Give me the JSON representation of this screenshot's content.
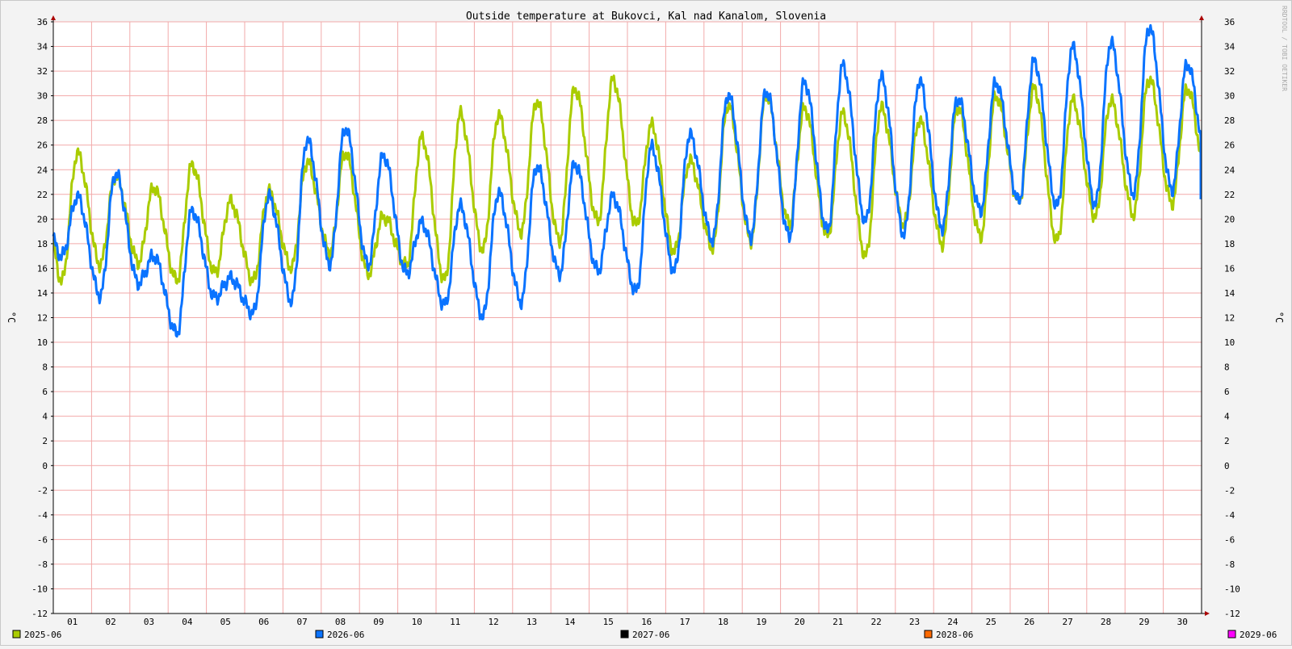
{
  "chart_data": {
    "type": "line",
    "title": "Outside temperature at Bukovci, Kal nad Kanalom, Slovenia",
    "ylabel_left": "°C",
    "ylabel_right": "°C",
    "watermark": "RRDTOOL / TOBI OETIKER",
    "ylim": [
      -12,
      36
    ],
    "y_ticks": [
      "36",
      "34",
      "32",
      "30",
      "28",
      "26",
      "24",
      "22",
      "20",
      "18",
      "16",
      "14",
      "12",
      "10",
      "8",
      "6",
      "4",
      "2",
      "0",
      "-2",
      "-4",
      "-6",
      "-8",
      "-10",
      "-12"
    ],
    "x_ticks": [
      "01",
      "02",
      "03",
      "04",
      "05",
      "06",
      "07",
      "08",
      "09",
      "10",
      "11",
      "12",
      "13",
      "14",
      "15",
      "16",
      "17",
      "18",
      "19",
      "20",
      "21",
      "22",
      "23",
      "24",
      "25",
      "26",
      "27",
      "28",
      "29",
      "30"
    ],
    "grid": true,
    "legend": [
      {
        "label": "2025-06",
        "color": "#aacc00"
      },
      {
        "label": "2026-06",
        "color": "#0a73ff"
      },
      {
        "label": "2027-06",
        "color": "#000000"
      },
      {
        "label": "2028-06",
        "color": "#ff6a00"
      },
      {
        "label": "2029-06",
        "color": "#ff00ff"
      }
    ],
    "series": [
      {
        "name": "2025-06",
        "color": "#aacc00",
        "daily_min": [
          15.0,
          16.3,
          16.5,
          15.0,
          15.6,
          15.0,
          16.1,
          17.3,
          15.6,
          16.2,
          15.0,
          17.5,
          19.0,
          18.3,
          19.8,
          19.5,
          17.3,
          17.7,
          18.3,
          19.6,
          18.6,
          17.0,
          19.6,
          18.0,
          18.6,
          21.4,
          18.2,
          20.2,
          20.4,
          21.3
        ],
        "daily_max": [
          25.3,
          23.5,
          22.6,
          24.4,
          21.4,
          22.2,
          24.6,
          25.4,
          20.2,
          26.6,
          28.5,
          28.4,
          29.6,
          30.6,
          31.3,
          27.6,
          24.7,
          29.3,
          30.1,
          29.0,
          28.5,
          29.0,
          28.0,
          29.1,
          30.0,
          30.6,
          29.6,
          29.6,
          31.4,
          30.6
        ],
        "end_value": 24.3
      },
      {
        "name": "2026-06",
        "color": "#0a73ff",
        "daily_min": [
          17.0,
          13.8,
          14.8,
          10.7,
          13.6,
          12.4,
          13.4,
          16.4,
          16.3,
          15.6,
          13.0,
          12.1,
          13.3,
          15.6,
          15.8,
          14.1,
          15.8,
          18.3,
          18.6,
          18.6,
          19.0,
          19.8,
          18.8,
          19.3,
          20.7,
          21.4,
          21.0,
          21.2,
          22.1,
          22.4
        ],
        "daily_max": [
          21.8,
          23.7,
          17.0,
          20.7,
          15.2,
          21.8,
          26.4,
          27.4,
          25.2,
          19.7,
          21.0,
          22.1,
          24.3,
          24.5,
          21.8,
          25.8,
          26.8,
          30.1,
          30.4,
          31.1,
          32.4,
          31.5,
          31.2,
          29.8,
          31.1,
          32.8,
          33.9,
          34.3,
          35.6,
          32.6
        ],
        "start_value": 18.6,
        "end_value": 21.6
      }
    ]
  }
}
